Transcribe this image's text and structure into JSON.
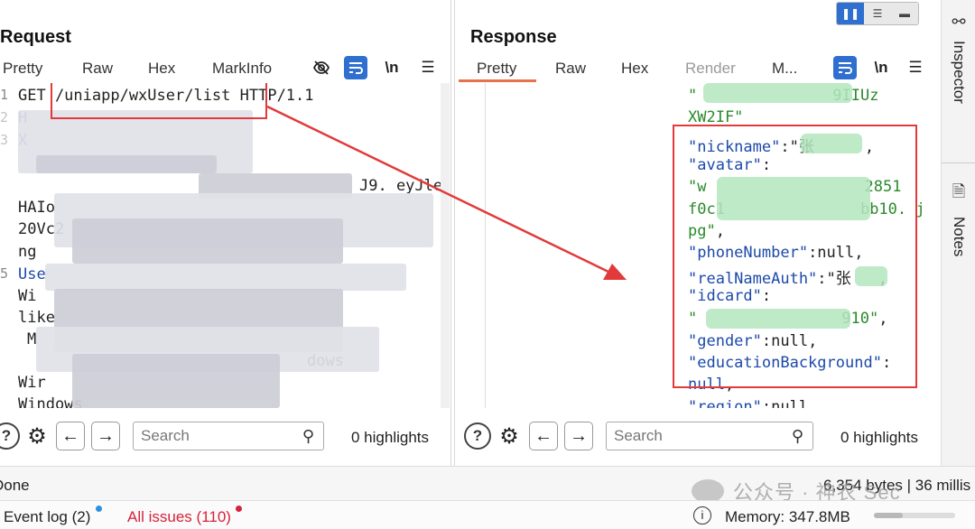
{
  "request": {
    "title": "Request",
    "tabs": [
      "Pretty",
      "Raw",
      "Hex",
      "MarkInfo"
    ],
    "toolbar": {
      "hide_icon": "eye-off-icon",
      "wrap_icon": "wrap-icon",
      "newline_label": "\\n",
      "menu_icon": "menu-icon"
    },
    "line_numbers": [
      "1",
      "2",
      "3",
      "5"
    ],
    "lines": [
      "GET /uniapp/wxUser/list HTTP/1.1",
      "H",
      "X",
      "J9. eyJle",
      "HAIo",
      "20Vc2",
      "ng",
      "Use",
      "Wi",
      "like",
      "M",
      "dows",
      "Wir",
      "Windows"
    ],
    "search": {
      "placeholder": "Search",
      "highlights": "0 highlights"
    }
  },
  "response": {
    "title": "Response",
    "tabs": [
      "Pretty",
      "Raw",
      "Hex",
      "Render",
      "M..."
    ],
    "toolbar": {
      "wrap_icon": "wrap-icon",
      "newline_label": "\\n",
      "menu_icon": "menu-icon"
    },
    "lines": [
      {
        "k": "\"",
        "v": "9IIUz"
      },
      {
        "k": "XW2IF\"",
        "v": ""
      },
      {
        "k": "\"nickname\"",
        "v": ":\"张",
        "end": ","
      },
      {
        "k": "\"avatar\"",
        "v": ":",
        "end": ""
      },
      {
        "k": "\"w",
        "v": "2851",
        "end": ""
      },
      {
        "k": "f0c1",
        "v": "bb10. j",
        "end": ""
      },
      {
        "k": "pg\"",
        "v": ",",
        "end": ""
      },
      {
        "k": "\"phoneNumber\"",
        "v": ":null",
        "end": ","
      },
      {
        "k": "\"realNameAuth\"",
        "v": ":\"张",
        "end": ","
      },
      {
        "k": "\"idcard\"",
        "v": ":",
        "end": ""
      },
      {
        "k": "\"",
        "v": "910\"",
        "end": ","
      },
      {
        "k": "\"gender\"",
        "v": ":null",
        "end": ","
      },
      {
        "k": "\"educationBackground\"",
        "v": ":",
        "end": ""
      },
      {
        "k": "null",
        "v": ",",
        "end": ""
      },
      {
        "k": "\"region\"",
        "v": ":null",
        "end": ""
      }
    ],
    "search": {
      "placeholder": "Search",
      "highlights": "0 highlights"
    }
  },
  "layout_toggle": [
    "split-columns-icon",
    "split-rows-icon",
    "single-pane-icon"
  ],
  "right_rail": [
    {
      "label": "Inspector",
      "icon": "inspector-icon"
    },
    {
      "label": "Notes",
      "icon": "notes-icon"
    }
  ],
  "status": {
    "left": "Done",
    "right": "6,354 bytes | 36 millis"
  },
  "bottom": {
    "event_log": "Event log (2)",
    "issues": "All issues (110)",
    "memory": "Memory: 347.8MB",
    "memory_fraction": 0.35
  },
  "watermark": "公众号 · 神农 Sec",
  "colors": {
    "accent": "#2f6fcf",
    "tab_underline": "#e8724d",
    "annotation_red": "#e23a3a",
    "issues_red": "#d6223c"
  }
}
